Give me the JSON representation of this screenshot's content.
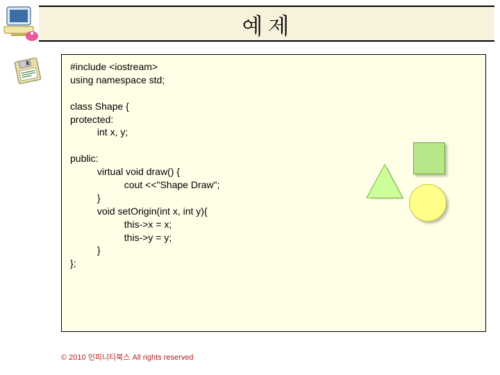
{
  "title": "예제",
  "code_lines": [
    "#include <iostream>",
    "using namespace std;",
    "",
    "class Shape {",
    "protected:",
    "          int x, y;",
    "",
    "public:",
    "          virtual void draw() {",
    "                    cout <<\"Shape Draw\";",
    "          }",
    "          void setOrigin(int x, int y){",
    "                    this->x = x;",
    "                    this->y = y;",
    "          }",
    "};"
  ],
  "footer": "© 2010 인피니티북스 All rights reserved",
  "icons": {
    "computer": "computer-icon",
    "floppy": "floppy-disk-icon"
  },
  "shapes": {
    "square_color": "#b6e788",
    "triangle_color": "#ccff99",
    "circle_color": "#ffff8a"
  }
}
